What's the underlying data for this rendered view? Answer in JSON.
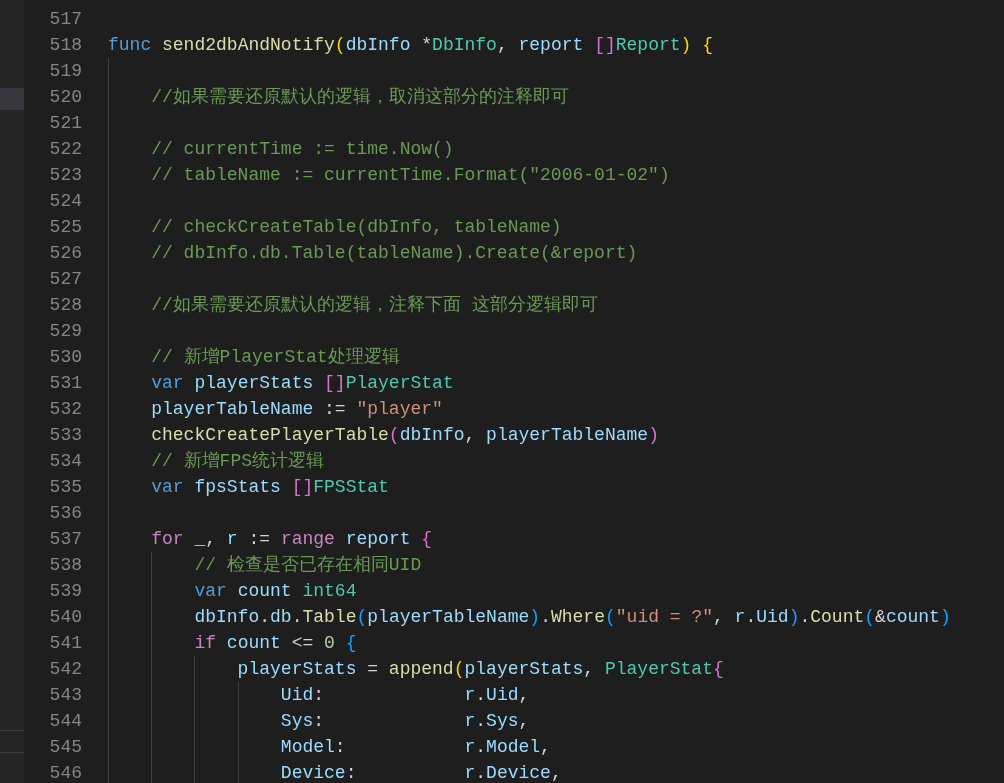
{
  "editor": {
    "lines": [
      {
        "number": "517"
      },
      {
        "number": "518",
        "tokens": [
          {
            "text": "func ",
            "kind": "keyword"
          },
          {
            "text": "send2dbAndNotify",
            "kind": "function"
          },
          {
            "text": "(",
            "kind": "bracket1"
          },
          {
            "text": "dbInfo",
            "kind": "variable"
          },
          {
            "text": " *",
            "kind": "plain"
          },
          {
            "text": "DbInfo",
            "kind": "type"
          },
          {
            "text": ", ",
            "kind": "plain"
          },
          {
            "text": "report ",
            "kind": "variable"
          },
          {
            "text": "[]",
            "kind": "bracket2"
          },
          {
            "text": "Report",
            "kind": "type"
          },
          {
            "text": ")",
            "kind": "bracket1"
          },
          {
            "text": " {",
            "kind": "bracket1"
          }
        ]
      },
      {
        "number": "519"
      },
      {
        "number": "520",
        "tokens": [
          {
            "text": "    //如果需要还原默认的逻辑，取消这部分的注释即可",
            "kind": "comment"
          }
        ]
      },
      {
        "number": "521"
      },
      {
        "number": "522",
        "tokens": [
          {
            "text": "    // currentTime := time.Now()",
            "kind": "comment"
          }
        ]
      },
      {
        "number": "523",
        "tokens": [
          {
            "text": "    // tableName := currentTime.Format(\"2006-01-02\")",
            "kind": "comment"
          }
        ]
      },
      {
        "number": "524"
      },
      {
        "number": "525",
        "tokens": [
          {
            "text": "    // checkCreateTable(dbInfo, tableName)",
            "kind": "comment"
          }
        ]
      },
      {
        "number": "526",
        "tokens": [
          {
            "text": "    // dbInfo.db.Table(tableName).Create(&report)",
            "kind": "comment"
          }
        ]
      },
      {
        "number": "527"
      },
      {
        "number": "528",
        "tokens": [
          {
            "text": "    //如果需要还原默认的逻辑，注释下面 这部分逻辑即可",
            "kind": "comment"
          }
        ]
      },
      {
        "number": "529"
      },
      {
        "number": "530",
        "tokens": [
          {
            "text": "    // 新增PlayerStat处理逻辑",
            "kind": "comment"
          }
        ]
      },
      {
        "number": "531",
        "tokens": [
          {
            "text": "    var ",
            "kind": "keyword"
          },
          {
            "text": "playerStats ",
            "kind": "variable"
          },
          {
            "text": "[]",
            "kind": "bracket2"
          },
          {
            "text": "PlayerStat",
            "kind": "type"
          }
        ]
      },
      {
        "number": "532",
        "tokens": [
          {
            "text": "    playerTableName",
            "kind": "variable"
          },
          {
            "text": " := ",
            "kind": "plain"
          },
          {
            "text": "\"player\"",
            "kind": "string"
          }
        ]
      },
      {
        "number": "533",
        "tokens": [
          {
            "text": "    checkCreatePlayerTable",
            "kind": "function"
          },
          {
            "text": "(",
            "kind": "bracket2"
          },
          {
            "text": "dbInfo",
            "kind": "variable"
          },
          {
            "text": ", ",
            "kind": "plain"
          },
          {
            "text": "playerTableName",
            "kind": "variable"
          },
          {
            "text": ")",
            "kind": "bracket2"
          }
        ]
      },
      {
        "number": "534",
        "tokens": [
          {
            "text": "    // 新增FPS统计逻辑",
            "kind": "comment"
          }
        ]
      },
      {
        "number": "535",
        "tokens": [
          {
            "text": "    var ",
            "kind": "keyword"
          },
          {
            "text": "fpsStats ",
            "kind": "variable"
          },
          {
            "text": "[]",
            "kind": "bracket2"
          },
          {
            "text": "FPSStat",
            "kind": "type"
          }
        ]
      },
      {
        "number": "536"
      },
      {
        "number": "537",
        "tokens": [
          {
            "text": "    for ",
            "kind": "control"
          },
          {
            "text": "_",
            "kind": "variable"
          },
          {
            "text": ", ",
            "kind": "plain"
          },
          {
            "text": "r",
            "kind": "variable"
          },
          {
            "text": " := ",
            "kind": "plain"
          },
          {
            "text": "range ",
            "kind": "control"
          },
          {
            "text": "report ",
            "kind": "variable"
          },
          {
            "text": "{",
            "kind": "bracket2"
          }
        ]
      },
      {
        "number": "538",
        "tokens": [
          {
            "text": "        // 检查是否已存在相同UID",
            "kind": "comment"
          }
        ]
      },
      {
        "number": "539",
        "tokens": [
          {
            "text": "        var ",
            "kind": "keyword"
          },
          {
            "text": "count ",
            "kind": "variable"
          },
          {
            "text": "int64",
            "kind": "type"
          }
        ]
      },
      {
        "number": "540",
        "tokens": [
          {
            "text": "        dbInfo",
            "kind": "variable"
          },
          {
            "text": ".",
            "kind": "plain"
          },
          {
            "text": "db",
            "kind": "variable"
          },
          {
            "text": ".",
            "kind": "plain"
          },
          {
            "text": "Table",
            "kind": "function"
          },
          {
            "text": "(",
            "kind": "bracket3"
          },
          {
            "text": "playerTableName",
            "kind": "variable"
          },
          {
            "text": ")",
            "kind": "bracket3"
          },
          {
            "text": ".",
            "kind": "plain"
          },
          {
            "text": "Where",
            "kind": "function"
          },
          {
            "text": "(",
            "kind": "bracket3"
          },
          {
            "text": "\"uid = ?\"",
            "kind": "string"
          },
          {
            "text": ", ",
            "kind": "plain"
          },
          {
            "text": "r",
            "kind": "variable"
          },
          {
            "text": ".",
            "kind": "plain"
          },
          {
            "text": "Uid",
            "kind": "variable"
          },
          {
            "text": ")",
            "kind": "bracket3"
          },
          {
            "text": ".",
            "kind": "plain"
          },
          {
            "text": "Count",
            "kind": "function"
          },
          {
            "text": "(",
            "kind": "bracket3"
          },
          {
            "text": "&",
            "kind": "plain"
          },
          {
            "text": "count",
            "kind": "variable"
          },
          {
            "text": ")",
            "kind": "bracket3"
          }
        ]
      },
      {
        "number": "541",
        "tokens": [
          {
            "text": "        if ",
            "kind": "control"
          },
          {
            "text": "count",
            "kind": "variable"
          },
          {
            "text": " <= ",
            "kind": "plain"
          },
          {
            "text": "0",
            "kind": "number"
          },
          {
            "text": " {",
            "kind": "bracket3"
          }
        ]
      },
      {
        "number": "542",
        "tokens": [
          {
            "text": "            playerStats",
            "kind": "variable"
          },
          {
            "text": " = ",
            "kind": "plain"
          },
          {
            "text": "append",
            "kind": "function"
          },
          {
            "text": "(",
            "kind": "bracket1"
          },
          {
            "text": "playerStats",
            "kind": "variable"
          },
          {
            "text": ", ",
            "kind": "plain"
          },
          {
            "text": "PlayerStat",
            "kind": "type"
          },
          {
            "text": "{",
            "kind": "bracket2"
          }
        ]
      },
      {
        "number": "543",
        "tokens": [
          {
            "text": "                Uid",
            "kind": "variable"
          },
          {
            "text": ":             ",
            "kind": "plain"
          },
          {
            "text": "r",
            "kind": "variable"
          },
          {
            "text": ".",
            "kind": "plain"
          },
          {
            "text": "Uid",
            "kind": "variable"
          },
          {
            "text": ",",
            "kind": "plain"
          }
        ]
      },
      {
        "number": "544",
        "tokens": [
          {
            "text": "                Sys",
            "kind": "variable"
          },
          {
            "text": ":             ",
            "kind": "plain"
          },
          {
            "text": "r",
            "kind": "variable"
          },
          {
            "text": ".",
            "kind": "plain"
          },
          {
            "text": "Sys",
            "kind": "variable"
          },
          {
            "text": ",",
            "kind": "plain"
          }
        ]
      },
      {
        "number": "545",
        "tokens": [
          {
            "text": "                Model",
            "kind": "variable"
          },
          {
            "text": ":           ",
            "kind": "plain"
          },
          {
            "text": "r",
            "kind": "variable"
          },
          {
            "text": ".",
            "kind": "plain"
          },
          {
            "text": "Model",
            "kind": "variable"
          },
          {
            "text": ",",
            "kind": "plain"
          }
        ]
      },
      {
        "number": "546",
        "tokens": [
          {
            "text": "                Device",
            "kind": "variable"
          },
          {
            "text": ":          ",
            "kind": "plain"
          },
          {
            "text": "r",
            "kind": "variable"
          },
          {
            "text": ".",
            "kind": "plain"
          },
          {
            "text": "Device",
            "kind": "variable"
          },
          {
            "text": ",",
            "kind": "plain"
          }
        ]
      }
    ]
  }
}
